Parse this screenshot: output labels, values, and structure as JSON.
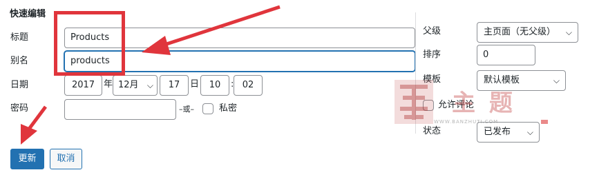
{
  "panel": {
    "title": "快速编辑"
  },
  "fields": {
    "title": {
      "label": "标题",
      "value": "Products"
    },
    "slug": {
      "label": "别名",
      "value": "products"
    },
    "date": {
      "label": "日期",
      "year": "2017",
      "year_unit": "年",
      "month": "12月",
      "day": "17",
      "day_unit": "日",
      "hour": "10",
      "separator": ":",
      "minute": "02"
    },
    "password": {
      "label": "密码",
      "value": "",
      "or_text": "–或–",
      "private_label": "私密"
    }
  },
  "right": {
    "parent": {
      "label": "父级",
      "value": "主页面（无父级）"
    },
    "order": {
      "label": "排序",
      "value": "0"
    },
    "template": {
      "label": "模板",
      "value": "默认模板"
    },
    "comments": {
      "label": "允许评论"
    },
    "status": {
      "label": "状态",
      "value": "已发布"
    }
  },
  "buttons": {
    "update": "更新",
    "cancel": "取消"
  },
  "watermark": {
    "main": "主 题",
    "url": "WWW.BANZHUTI.COM"
  },
  "colors": {
    "accent": "#2271b1",
    "annotation_red": "#e0353c"
  }
}
